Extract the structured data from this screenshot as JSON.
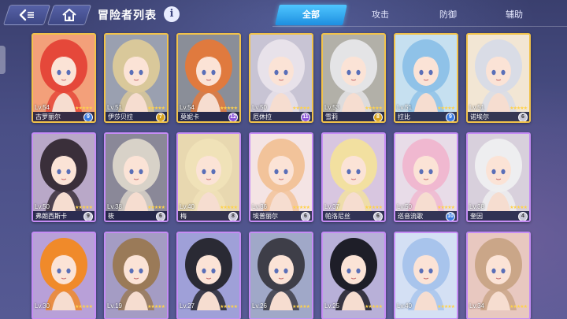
{
  "header": {
    "title": "冒险者列表",
    "info_label": "i"
  },
  "tabs": [
    {
      "label": "全部",
      "active": true
    },
    {
      "label": "攻击",
      "active": false
    },
    {
      "label": "防御",
      "active": false
    },
    {
      "label": "辅助",
      "active": false
    }
  ],
  "cards": [
    {
      "name": "古罗丽尔",
      "level": "Lv.54",
      "badge": "9",
      "badge_color": "blue",
      "frame": "gold",
      "hair": "#e5483a",
      "bg": "#f3a07a"
    },
    {
      "name": "伊莎贝拉",
      "level": "Lv.51",
      "badge": "7",
      "badge_color": "yellow",
      "frame": "gold",
      "hair": "#d9c89a",
      "bg": "#9aa0b0"
    },
    {
      "name": "莫妮卡",
      "level": "Lv.54",
      "badge": "12",
      "badge_color": "purple",
      "frame": "gold",
      "hair": "#e07a3e",
      "bg": "#8a8e98"
    },
    {
      "name": "厄休拉",
      "level": "Lv.50",
      "badge": "11",
      "badge_color": "purple",
      "frame": "gold",
      "hair": "#e8e2ea",
      "bg": "#c8c4d4"
    },
    {
      "name": "雪莉",
      "level": "Lv.53",
      "badge": "8",
      "badge_color": "yellow",
      "frame": "gold",
      "hair": "#e4e4e6",
      "bg": "#b2b0a8"
    },
    {
      "name": "拉比",
      "level": "Lv.51",
      "badge": "9",
      "badge_color": "blue",
      "frame": "gold",
      "hair": "#8fc2e8",
      "bg": "#c6e0f0"
    },
    {
      "name": "诺埃尔",
      "level": "Lv.51",
      "badge": "6",
      "badge_color": "white",
      "frame": "gold",
      "hair": "#d9dce6",
      "bg": "#f2e6d4"
    },
    {
      "name": "弗朗西斯卡",
      "level": "Lv.50",
      "badge": "9",
      "badge_color": "white",
      "frame": "purple",
      "hair": "#3a2f3a",
      "bg": "#b9a8c8"
    },
    {
      "name": "筱",
      "level": "Lv.38",
      "badge": "6",
      "badge_color": "white",
      "frame": "purple",
      "hair": "#d8d2c8",
      "bg": "#8a8898"
    },
    {
      "name": "梅",
      "level": "Lv.40",
      "badge": "8",
      "badge_color": "white",
      "frame": "purple",
      "hair": "#f0e2b8",
      "bg": "#e8d8b0"
    },
    {
      "name": "埃普丽尔",
      "level": "Lv.36",
      "badge": "6",
      "badge_color": "white",
      "frame": "purple",
      "hair": "#f2c39a",
      "bg": "#f4e4e4"
    },
    {
      "name": "帕洛尼丝",
      "level": "Lv.37",
      "badge": "6",
      "badge_color": "white",
      "frame": "purple",
      "hair": "#f2e0a0",
      "bg": "#d8c6e0"
    },
    {
      "name": "巡音流歌",
      "level": "Lv.50",
      "badge": "10",
      "badge_color": "blue",
      "frame": "purple",
      "hair": "#f0b8d0",
      "bg": "#e8dce8"
    },
    {
      "name": "奎因",
      "level": "Lv.38",
      "badge": "4",
      "badge_color": "white",
      "frame": "purple",
      "hair": "#eeeef0",
      "bg": "#d8d0dc"
    },
    {
      "name": "",
      "level": "Lv.30",
      "badge": "",
      "badge_color": "white",
      "frame": "purple",
      "hair": "#f08a2a",
      "bg": "#b8a0d8"
    },
    {
      "name": "",
      "level": "Lv.19",
      "badge": "",
      "badge_color": "white",
      "frame": "purple",
      "hair": "#9a7a58",
      "bg": "#a49cc4"
    },
    {
      "name": "",
      "level": "Lv.27",
      "badge": "",
      "badge_color": "white",
      "frame": "purple",
      "hair": "#2a2a34",
      "bg": "#9fa0d8"
    },
    {
      "name": "",
      "level": "Lv.26",
      "badge": "",
      "badge_color": "white",
      "frame": "purple",
      "hair": "#3e3e48",
      "bg": "#a0a8c8"
    },
    {
      "name": "",
      "level": "Lv.25",
      "badge": "",
      "badge_color": "white",
      "frame": "purple",
      "hair": "#1e1e28",
      "bg": "#b8b0d8"
    },
    {
      "name": "",
      "level": "Lv.40",
      "badge": "",
      "badge_color": "white",
      "frame": "purple",
      "hair": "#a8c4ec",
      "bg": "#d4e0f4"
    },
    {
      "name": "",
      "level": "Lv.34",
      "badge": "",
      "badge_color": "white",
      "frame": "purple",
      "hair": "#caa688",
      "bg": "#e8c8c0"
    }
  ],
  "stars_text": "★★★★★",
  "icons": {
    "back": "back-arrow-icon",
    "home": "home-icon",
    "info": "info-icon"
  }
}
